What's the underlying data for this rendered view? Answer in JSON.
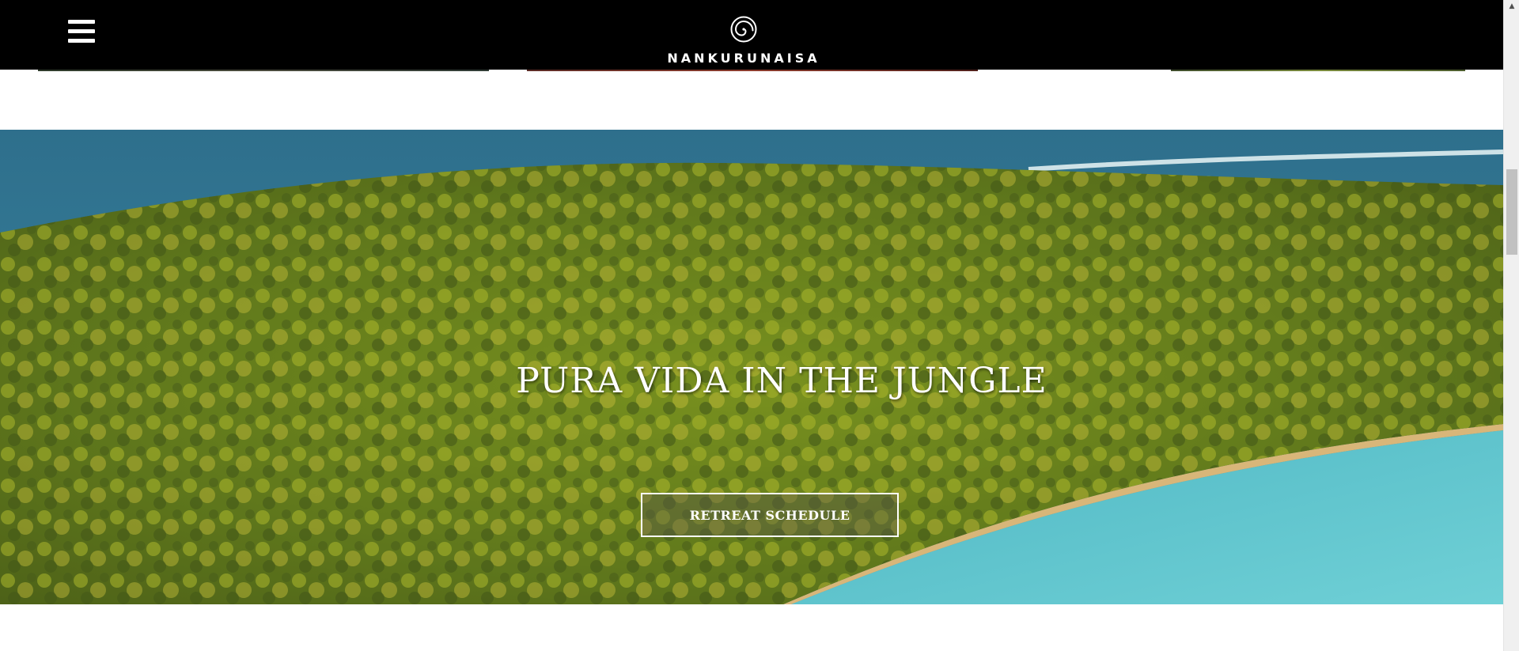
{
  "header": {
    "brand_name": "NANKURUNAISA",
    "logo_icon": "spiral-logo-icon",
    "menu_icon": "hamburger-menu-icon",
    "background_color": "#000000"
  },
  "hero": {
    "title": "PURA VIDA IN THE JUNGLE",
    "button_label": "RETREAT SCHEDULE",
    "background_image": "aerial palm jungle island with turquoise lagoon"
  },
  "scrollbar": {
    "up_arrow": "▲"
  }
}
